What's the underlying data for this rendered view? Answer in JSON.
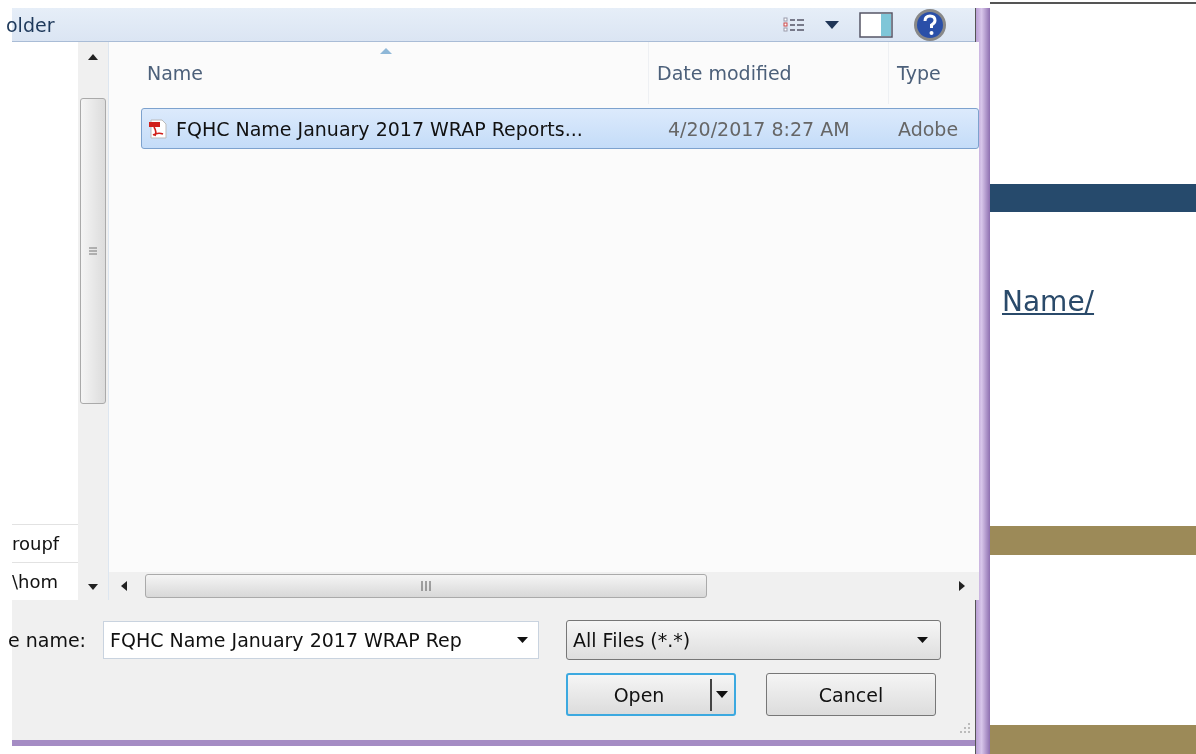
{
  "dialog": {
    "toolbar_title": "older",
    "nav_items": [
      "roupf",
      "\\hom"
    ],
    "columns": [
      {
        "label": "Name",
        "sorted": true
      },
      {
        "label": "Date modified",
        "sorted": false
      },
      {
        "label": "Type",
        "sorted": false
      }
    ],
    "rows": [
      {
        "name": "FQHC Name January 2017 WRAP Reports...",
        "date": "4/20/2017 8:27 AM",
        "type": "Adobe",
        "selected": true
      }
    ],
    "file_name_label": "e name:",
    "file_name": "FQHC Name January 2017 WRAP Rep",
    "file_type": "All Files (*.*)",
    "buttons": [
      {
        "label": "Open",
        "kind": "split",
        "default": true
      },
      {
        "label": "Cancel",
        "kind": "plain",
        "default": false
      }
    ]
  },
  "page": {
    "link": "Name/"
  }
}
